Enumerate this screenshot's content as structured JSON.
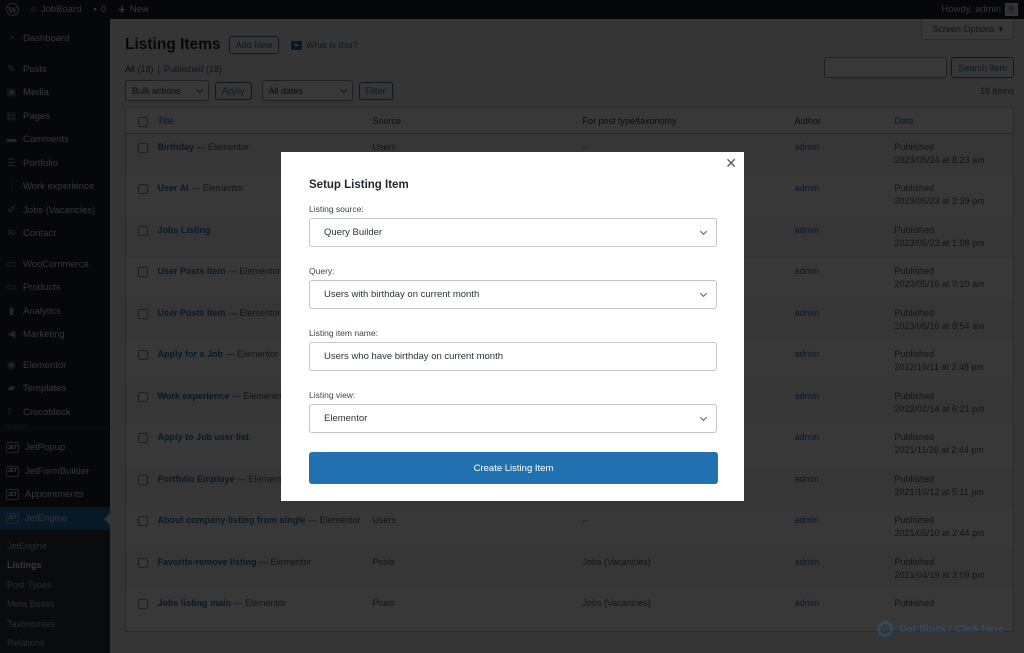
{
  "adminbar": {
    "site_name": "JobBoard",
    "comments_count": "0",
    "new_label": "New",
    "howdy": "Howdy, admin"
  },
  "sidebar": {
    "items": [
      {
        "label": "Dashboard",
        "icon": "dashboard-icon"
      },
      {
        "label": "Posts",
        "icon": "pin-icon"
      },
      {
        "label": "Media",
        "icon": "media-icon"
      },
      {
        "label": "Pages",
        "icon": "pages-icon"
      },
      {
        "label": "Comments",
        "icon": "comment-icon"
      },
      {
        "label": "Portfolio",
        "icon": "list-icon"
      },
      {
        "label": "Work experience",
        "icon": "list-bullets-icon"
      },
      {
        "label": "Jobs (Vacancies)",
        "icon": "edit-icon"
      },
      {
        "label": "Contact",
        "icon": "mail-icon"
      },
      {
        "label": "WooCommerce",
        "icon": "woo-icon"
      },
      {
        "label": "Products",
        "icon": "archive-icon"
      },
      {
        "label": "Analytics",
        "icon": "chart-bar-icon"
      },
      {
        "label": "Marketing",
        "icon": "megaphone-icon"
      },
      {
        "label": "Elementor",
        "icon": "elementor-icon"
      },
      {
        "label": "Templates",
        "icon": "folder-icon"
      },
      {
        "label": "Crocoblock",
        "icon": "crocoblock-icon"
      }
    ],
    "plugins_label": "PLUGINS",
    "plugin_items": [
      {
        "label": "JetPopup",
        "icon": "jet-icon"
      },
      {
        "label": "JetFormBuilder",
        "icon": "jet-icon"
      },
      {
        "label": "Appointments",
        "icon": "jet-icon"
      },
      {
        "label": "JetEngine",
        "icon": "jet-icon"
      }
    ],
    "submenu": [
      "JetEngine",
      "Listings",
      "Post Types",
      "Meta Boxes",
      "Taxonomies",
      "Relations"
    ]
  },
  "page": {
    "screen_options": "Screen Options",
    "title": "Listing Items",
    "add_new": "Add New",
    "what_is_this": "What is this?",
    "filter_all": "All",
    "filter_all_count": "(18)",
    "filter_published": "Published",
    "filter_published_count": "(18)",
    "search_button": "Search Item",
    "bulk_actions": "Bulk actions",
    "apply": "Apply",
    "all_dates": "All dates",
    "filter": "Filter",
    "items_count": "18 items"
  },
  "table": {
    "headers": [
      "Title",
      "Source",
      "For post type/taxonomy",
      "Author",
      "Date"
    ],
    "rows": [
      {
        "title": "Birthday",
        "suffix": " — Elementor",
        "source": "Users",
        "type": "--",
        "author": "admin",
        "status": "Published",
        "date": "2023/05/24 at 8:23 am"
      },
      {
        "title": "User AI",
        "suffix": " — Elementor",
        "source": "",
        "type": "",
        "author": "admin",
        "status": "Published",
        "date": "2023/05/23 at 2:39 pm"
      },
      {
        "title": "Jobs Listing",
        "suffix": "",
        "source": "",
        "type": "",
        "author": "admin",
        "status": "Published",
        "date": "2023/05/23 at 1:08 pm"
      },
      {
        "title": "User Posts Item",
        "suffix": " — Elementor",
        "source": "",
        "type": "",
        "author": "admin",
        "status": "Published",
        "date": "2023/05/16 at 9:10 am"
      },
      {
        "title": "User Posts Item",
        "suffix": " — Elementor",
        "source": "",
        "type": "",
        "author": "admin",
        "status": "Published",
        "date": "2023/05/16 at 8:54 am"
      },
      {
        "title": "Apply for a Job",
        "suffix": " — Elementor",
        "source": "",
        "type": "",
        "author": "admin",
        "status": "Published",
        "date": "2022/10/11 at 2:48 pm"
      },
      {
        "title": "Work experience",
        "suffix": " — Elementor",
        "source": "",
        "type": "",
        "author": "admin",
        "status": "Published",
        "date": "2022/02/14 at 6:21 pm"
      },
      {
        "title": "Apply to Job user list",
        "suffix": "",
        "source": "",
        "type": "",
        "author": "admin",
        "status": "Published",
        "date": "2021/11/26 at 2:44 pm"
      },
      {
        "title": "Portfolio Employe",
        "suffix": " — Elementor",
        "source": "",
        "type": "",
        "author": "admin",
        "status": "Published",
        "date": "2021/10/12 at 5:11 pm"
      },
      {
        "title": "About company listing from single",
        "suffix": " — Elementor",
        "source": "Users",
        "type": "--",
        "author": "admin",
        "status": "Published",
        "date": "2021/05/10 at 2:44 pm"
      },
      {
        "title": "Favorite-remove listing",
        "suffix": " — Elementor",
        "source": "Posts",
        "type": "Jobs (Vacancies)",
        "author": "admin",
        "status": "Published",
        "date": "2021/04/19 at 3:09 pm"
      },
      {
        "title": "Jobs listing main",
        "suffix": " — Elementor",
        "source": "Posts",
        "type": "Jobs (Vacancies)",
        "author": "admin",
        "status": "Published",
        "date": ""
      }
    ]
  },
  "modal": {
    "title": "Setup Listing Item",
    "source_label": "Listing source:",
    "source_value": "Query Builder",
    "query_label": "Query:",
    "query_value": "Users with birthday on current month",
    "name_label": "Listing item name:",
    "name_value": "Users who have birthday on current month",
    "view_label": "Listing view:",
    "view_value": "Elementor",
    "create_button": "Create Listing Item"
  },
  "help": {
    "label": "Got Stuck? Click Here"
  },
  "colors": {
    "accent": "#2271b1",
    "sidebar_bg": "#1d2327"
  }
}
